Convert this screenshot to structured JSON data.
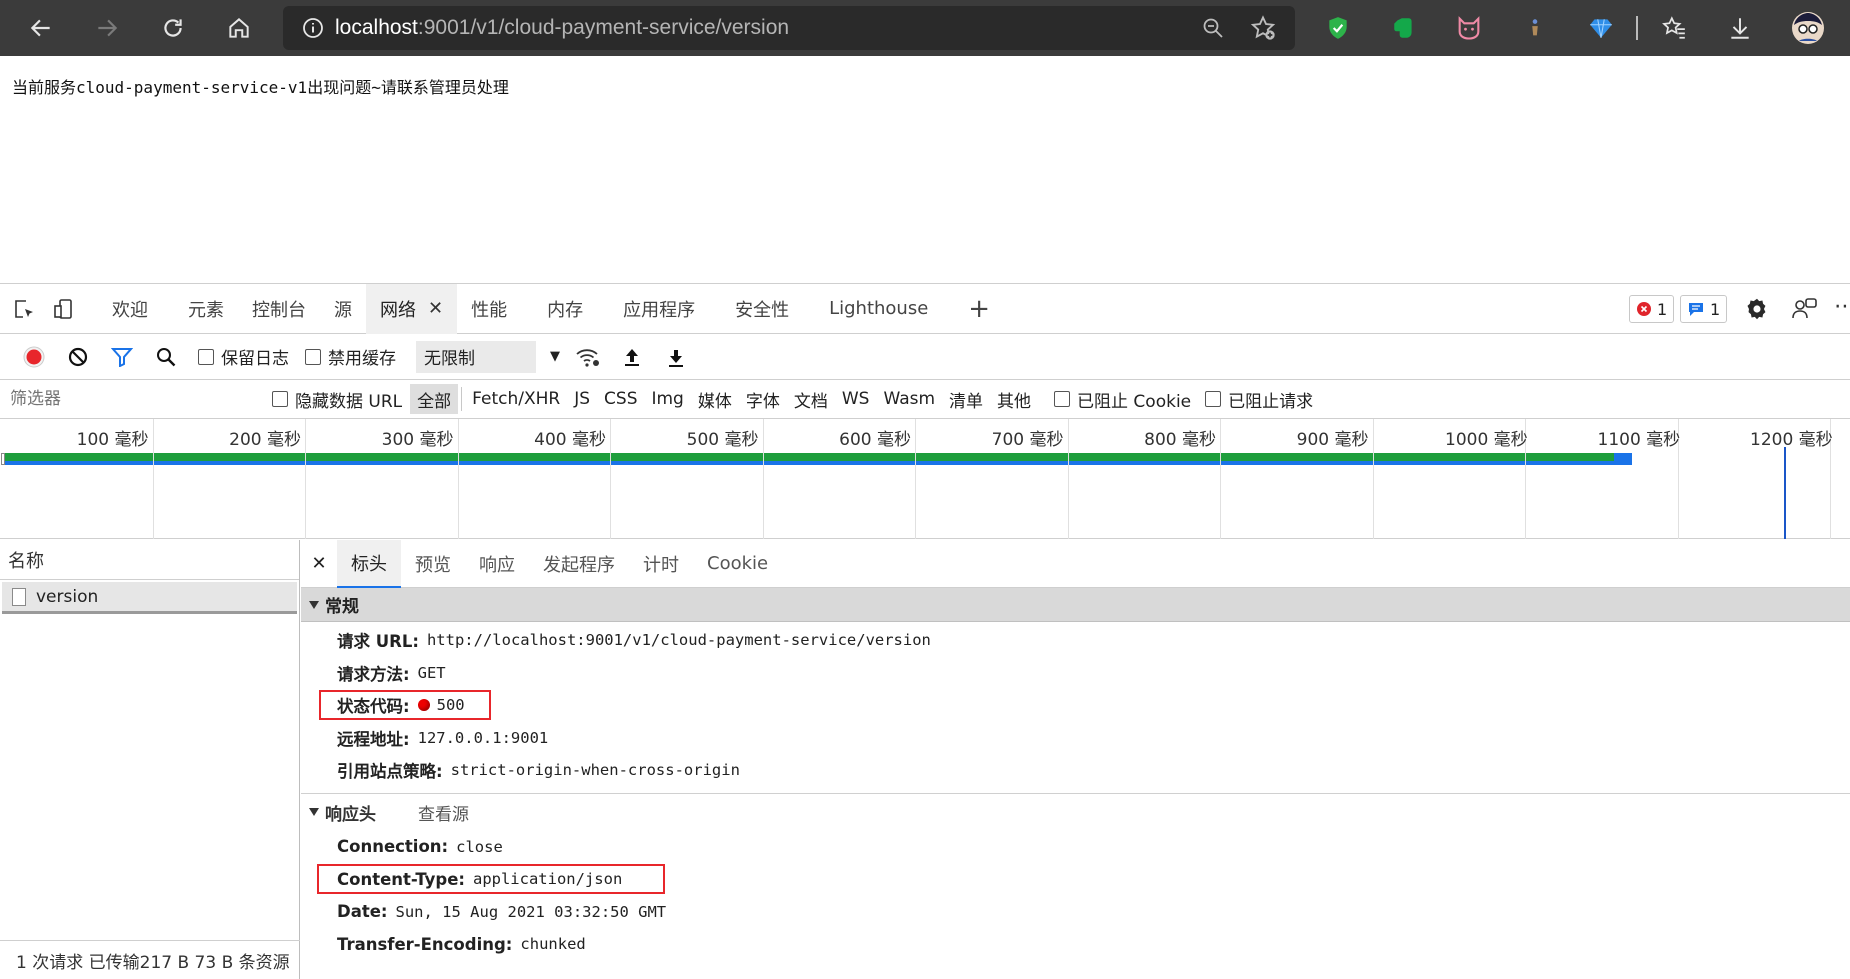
{
  "browser": {
    "url_host": "localhost",
    "url_rest": ":9001/v1/cloud-payment-service/version"
  },
  "page": {
    "message": "当前服务cloud-payment-service-v1出现问题~请联系管理员处理"
  },
  "devtools": {
    "tabs": [
      "欢迎",
      "元素",
      "控制台",
      "源",
      "网络",
      "性能",
      "内存",
      "应用程序",
      "安全性",
      "Lighthouse"
    ],
    "active_tab": "网络",
    "error_count": "1",
    "message_count": "1",
    "network": {
      "preserve_log": "保留日志",
      "disable_cache": "禁用缓存",
      "throttle": "无限制",
      "filter_placeholder": "筛选器",
      "hide_data_urls": "隐藏数据 URL",
      "types": [
        "全部",
        "Fetch/XHR",
        "JS",
        "CSS",
        "Img",
        "媒体",
        "字体",
        "文档",
        "WS",
        "Wasm",
        "清单",
        "其他"
      ],
      "blocked_cookies": "已阻止 Cookie",
      "blocked_requests": "已阻止请求",
      "timeline_ticks": [
        "100 毫秒",
        "200 毫秒",
        "300 毫秒",
        "400 毫秒",
        "500 毫秒",
        "600 毫秒",
        "700 毫秒",
        "800 毫秒",
        "900 毫秒",
        "1000 毫秒",
        "1100 毫秒",
        "1200 毫秒"
      ],
      "name_header": "名称",
      "requests": [
        {
          "name": "version"
        }
      ],
      "status_bar": "1 次请求  已传输217 B  73 B 条资源"
    },
    "details": {
      "tabs": [
        "标头",
        "预览",
        "响应",
        "发起程序",
        "计时",
        "Cookie"
      ],
      "active": "标头",
      "general_title": "常规",
      "general": [
        {
          "k": "请求 URL:",
          "v": "http://localhost:9001/v1/cloud-payment-service/version"
        },
        {
          "k": "请求方法:",
          "v": "GET"
        },
        {
          "k": "状态代码:",
          "v": "500"
        },
        {
          "k": "远程地址:",
          "v": "127.0.0.1:9001"
        },
        {
          "k": "引用站点策略:",
          "v": "strict-origin-when-cross-origin"
        }
      ],
      "response_title": "响应头",
      "view_source": "查看源",
      "response": [
        {
          "k": "Connection:",
          "v": "close"
        },
        {
          "k": "Content-Type:",
          "v": "application/json"
        },
        {
          "k": "Date:",
          "v": "Sun, 15 Aug 2021 03:32:50 GMT"
        },
        {
          "k": "Transfer-Encoding:",
          "v": "chunked"
        }
      ]
    }
  }
}
